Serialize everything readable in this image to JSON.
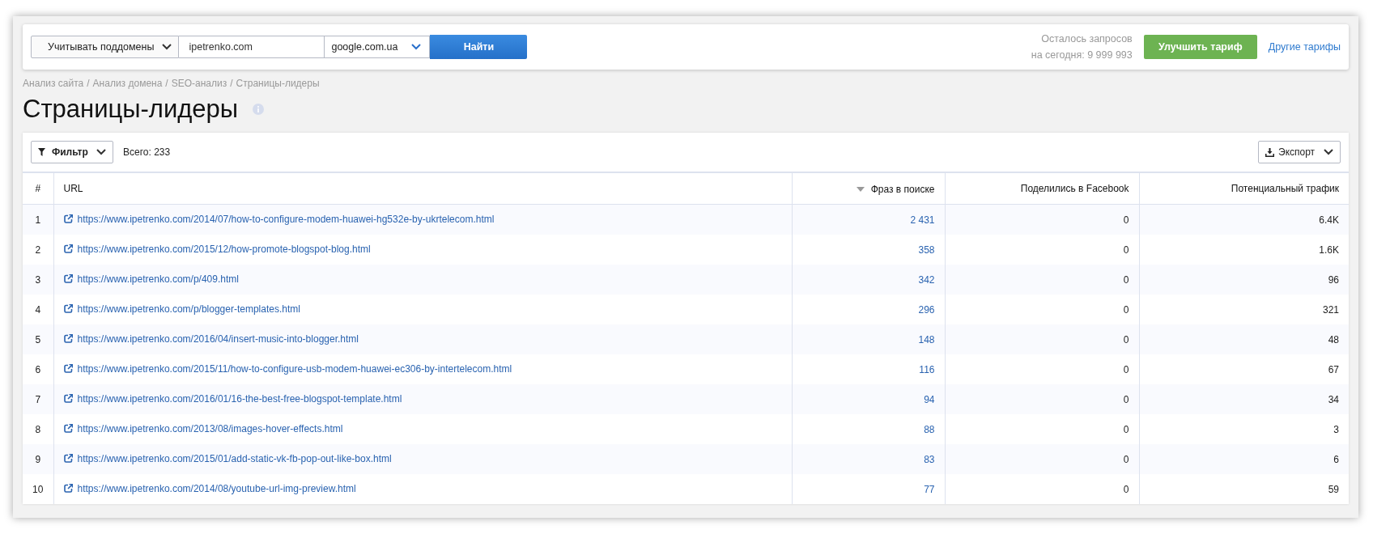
{
  "search_bar": {
    "subdomain_toggle": "Учитывать поддомены",
    "domain_field": "ipetrenko.com",
    "engine_select": "google.com.ua",
    "search_button": "Найти"
  },
  "quota": {
    "line_1": "Осталось запросов",
    "line_2": "на сегодня: 9 999 993"
  },
  "upgrade_button": "Улучшить тариф",
  "other_plans_link": "Другие тарифы",
  "breadcrumb_separator": "/",
  "breadcrumbs": [
    "Анализ сайта",
    "Анализ домена",
    "SEO-анализ",
    "Страницы-лидеры"
  ],
  "page_title": "Страницы-лидеры",
  "toolbar": {
    "filter_button": "Фильтр",
    "total": "Всего: 233",
    "export_button": "Экспорт"
  },
  "table": {
    "columns": [
      {
        "label": "#",
        "sorted": false
      },
      {
        "label": "URL",
        "sorted": false
      },
      {
        "label": "Фраз в поиске",
        "sorted": true
      },
      {
        "label": "Поделились в Facebook",
        "sorted": false
      },
      {
        "label": "Потенциальный трафик",
        "sorted": false
      }
    ],
    "rows": [
      {
        "n": "1",
        "url": "https://www.ipetrenko.com/2014/07/how-to-configure-modem-huawei-hg532e-by-ukrtelecom.html",
        "phrases": "2 431",
        "facebook": "0",
        "traffic": "6.4K"
      },
      {
        "n": "2",
        "url": "https://www.ipetrenko.com/2015/12/how-promote-blogspot-blog.html",
        "phrases": "358",
        "facebook": "0",
        "traffic": "1.6K"
      },
      {
        "n": "3",
        "url": "https://www.ipetrenko.com/p/409.html",
        "phrases": "342",
        "facebook": "0",
        "traffic": "96"
      },
      {
        "n": "4",
        "url": "https://www.ipetrenko.com/p/blogger-templates.html",
        "phrases": "296",
        "facebook": "0",
        "traffic": "321"
      },
      {
        "n": "5",
        "url": "https://www.ipetrenko.com/2016/04/insert-music-into-blogger.html",
        "phrases": "148",
        "facebook": "0",
        "traffic": "48"
      },
      {
        "n": "6",
        "url": "https://www.ipetrenko.com/2015/11/how-to-configure-usb-modem-huawei-ec306-by-intertelecom.html",
        "phrases": "116",
        "facebook": "0",
        "traffic": "67"
      },
      {
        "n": "7",
        "url": "https://www.ipetrenko.com/2016/01/16-the-best-free-blogspot-template.html",
        "phrases": "94",
        "facebook": "0",
        "traffic": "34"
      },
      {
        "n": "8",
        "url": "https://www.ipetrenko.com/2013/08/images-hover-effects.html",
        "phrases": "88",
        "facebook": "0",
        "traffic": "3"
      },
      {
        "n": "9",
        "url": "https://www.ipetrenko.com/2015/01/add-static-vk-fb-pop-out-like-box.html",
        "phrases": "83",
        "facebook": "0",
        "traffic": "6"
      },
      {
        "n": "10",
        "url": "https://www.ipetrenko.com/2014/08/youtube-url-img-preview.html",
        "phrases": "77",
        "facebook": "0",
        "traffic": "59"
      }
    ]
  }
}
